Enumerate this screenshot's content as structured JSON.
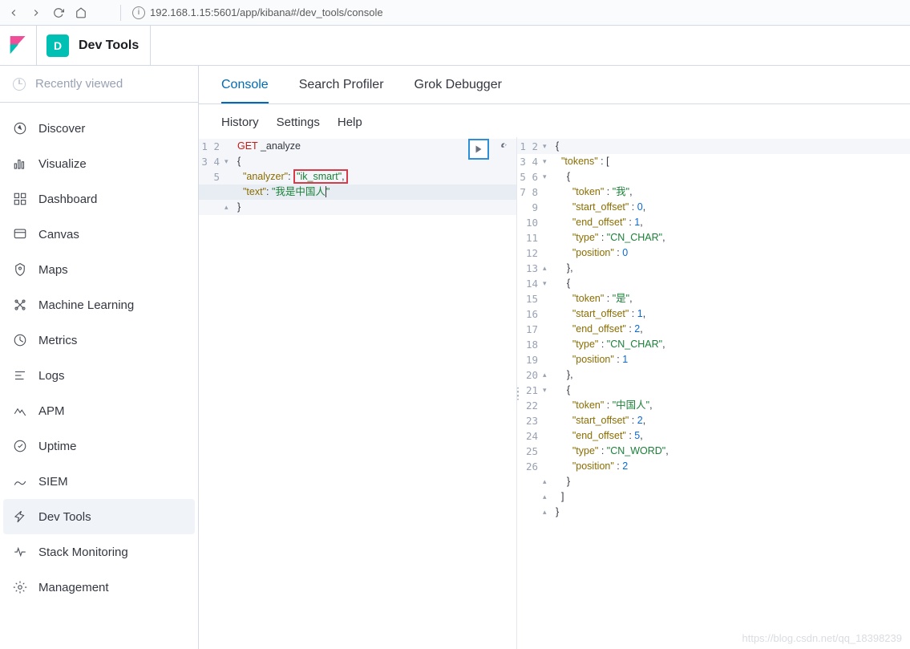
{
  "browser": {
    "url": "192.168.1.15:5601/app/kibana#/dev_tools/console"
  },
  "header": {
    "badge_letter": "D",
    "title": "Dev Tools"
  },
  "sidebar": {
    "recent_label": "Recently viewed",
    "items": [
      {
        "label": "Discover"
      },
      {
        "label": "Visualize"
      },
      {
        "label": "Dashboard"
      },
      {
        "label": "Canvas"
      },
      {
        "label": "Maps"
      },
      {
        "label": "Machine Learning"
      },
      {
        "label": "Metrics"
      },
      {
        "label": "Logs"
      },
      {
        "label": "APM"
      },
      {
        "label": "Uptime"
      },
      {
        "label": "SIEM"
      },
      {
        "label": "Dev Tools"
      },
      {
        "label": "Stack Monitoring"
      },
      {
        "label": "Management"
      }
    ]
  },
  "tabs": [
    {
      "label": "Console",
      "active": true
    },
    {
      "label": "Search Profiler"
    },
    {
      "label": "Grok Debugger"
    }
  ],
  "toolbar": {
    "history": "History",
    "settings": "Settings",
    "help": "Help"
  },
  "request_editor": {
    "method": "GET",
    "path": "_analyze",
    "analyzer_key": "\"analyzer\"",
    "analyzer_val": "\"ik_smart\"",
    "text_key": "\"text\"",
    "text_val": "\"我是中国人\"",
    "line_numbers": [
      "1",
      "2",
      "3",
      "4",
      "5"
    ]
  },
  "response_editor": {
    "lines": [
      {
        "n": "1",
        "fold": "▾",
        "txt": "{"
      },
      {
        "n": "2",
        "fold": "▾",
        "txt": "  \"tokens\" : ["
      },
      {
        "n": "3",
        "fold": "▾",
        "txt": "    {"
      },
      {
        "n": "4",
        "fold": "",
        "txt": "      \"token\" : \"我\","
      },
      {
        "n": "5",
        "fold": "",
        "txt": "      \"start_offset\" : 0,"
      },
      {
        "n": "6",
        "fold": "",
        "txt": "      \"end_offset\" : 1,"
      },
      {
        "n": "7",
        "fold": "",
        "txt": "      \"type\" : \"CN_CHAR\","
      },
      {
        "n": "8",
        "fold": "",
        "txt": "      \"position\" : 0"
      },
      {
        "n": "9",
        "fold": "▴",
        "txt": "    },"
      },
      {
        "n": "10",
        "fold": "▾",
        "txt": "    {"
      },
      {
        "n": "11",
        "fold": "",
        "txt": "      \"token\" : \"是\","
      },
      {
        "n": "12",
        "fold": "",
        "txt": "      \"start_offset\" : 1,"
      },
      {
        "n": "13",
        "fold": "",
        "txt": "      \"end_offset\" : 2,"
      },
      {
        "n": "14",
        "fold": "",
        "txt": "      \"type\" : \"CN_CHAR\","
      },
      {
        "n": "15",
        "fold": "",
        "txt": "      \"position\" : 1"
      },
      {
        "n": "16",
        "fold": "▴",
        "txt": "    },"
      },
      {
        "n": "17",
        "fold": "▾",
        "txt": "    {"
      },
      {
        "n": "18",
        "fold": "",
        "txt": "      \"token\" : \"中国人\","
      },
      {
        "n": "19",
        "fold": "",
        "txt": "      \"start_offset\" : 2,"
      },
      {
        "n": "20",
        "fold": "",
        "txt": "      \"end_offset\" : 5,"
      },
      {
        "n": "21",
        "fold": "",
        "txt": "      \"type\" : \"CN_WORD\","
      },
      {
        "n": "22",
        "fold": "",
        "txt": "      \"position\" : 2"
      },
      {
        "n": "23",
        "fold": "▴",
        "txt": "    }"
      },
      {
        "n": "24",
        "fold": "▴",
        "txt": "  ]"
      },
      {
        "n": "25",
        "fold": "▴",
        "txt": "}"
      },
      {
        "n": "26",
        "fold": "",
        "txt": ""
      }
    ]
  },
  "watermark": "https://blog.csdn.net/qq_18398239"
}
